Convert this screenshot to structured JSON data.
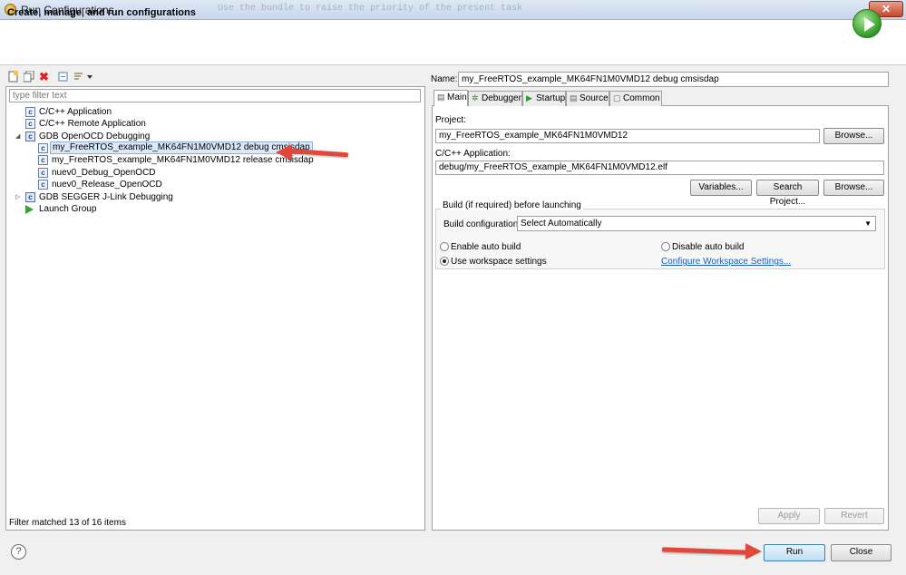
{
  "window": {
    "title": "Run Configurations",
    "ghost_text": "Use the bundle to raise the priority of the present task",
    "close_glyph": "✕"
  },
  "header": {
    "title": "Create, manage, and run configurations",
    "run_icon": "run-icon"
  },
  "left": {
    "toolbar_icons": [
      "new-config-icon",
      "duplicate-icon",
      "delete-icon",
      "collapse-all-icon",
      "filter-icon"
    ],
    "filter_placeholder": "type filter text",
    "tree": [
      {
        "label": "C/C++ Application",
        "level": 0,
        "twisty": "",
        "icon": "c-app-icon"
      },
      {
        "label": "C/C++ Remote Application",
        "level": 0,
        "twisty": "",
        "icon": "c-app-icon"
      },
      {
        "label": "GDB OpenOCD Debugging",
        "level": 0,
        "twisty": "◢",
        "icon": "gdb-icon"
      },
      {
        "label": "my_FreeRTOS_example_MK64FN1M0VMD12 debug cmsisdap",
        "level": 1,
        "twisty": "",
        "icon": "c-app-icon",
        "selected": true
      },
      {
        "label": "my_FreeRTOS_example_MK64FN1M0VMD12 release cmsisdap",
        "level": 1,
        "twisty": "",
        "icon": "c-app-icon"
      },
      {
        "label": "nuev0_Debug_OpenOCD",
        "level": 1,
        "twisty": "",
        "icon": "c-app-icon"
      },
      {
        "label": "nuev0_Release_OpenOCD",
        "level": 1,
        "twisty": "",
        "icon": "c-app-icon"
      },
      {
        "label": "GDB SEGGER J-Link Debugging",
        "level": 0,
        "twisty": "▷",
        "icon": "gdb-icon"
      },
      {
        "label": "Launch Group",
        "level": 0,
        "twisty": "",
        "icon": "launch-group-icon"
      }
    ],
    "status": "Filter matched 13 of 16 items"
  },
  "right": {
    "name_label": "Name:",
    "name_value": "my_FreeRTOS_example_MK64FN1M0VMD12 debug cmsisdap",
    "tabs": [
      {
        "label": "Main",
        "icon": "main-tab-icon",
        "glyph": "▤",
        "active": true
      },
      {
        "label": "Debugger",
        "icon": "debugger-tab-icon",
        "glyph": "✲"
      },
      {
        "label": "Startup",
        "icon": "startup-tab-icon",
        "glyph": "▶"
      },
      {
        "label": "Source",
        "icon": "source-tab-icon",
        "glyph": "▤"
      },
      {
        "label": "Common",
        "icon": "common-tab-icon",
        "glyph": "▢"
      }
    ],
    "project_label": "Project:",
    "project_value": "my_FreeRTOS_example_MK64FN1M0VMD12",
    "browse_label": "Browse...",
    "app_label": "C/C++ Application:",
    "app_value": "debug/my_FreeRTOS_example_MK64FN1M0VMD12.elf",
    "variables_label": "Variables...",
    "search_project_label": "Search Project...",
    "build_group_title": "Build (if required) before launching",
    "build_config_label": "Build configuration:",
    "build_config_value": "Select Automatically",
    "enable_auto_build": "Enable auto build",
    "disable_auto_build": "Disable auto build",
    "use_workspace_settings": "Use workspace settings",
    "configure_workspace_link": "Configure Workspace Settings...",
    "selected_option": "use_workspace_settings",
    "apply_label": "Apply",
    "revert_label": "Revert"
  },
  "footer": {
    "help_glyph": "?",
    "run_label": "Run",
    "close_label": "Close"
  },
  "colors": {
    "annotation_arrow": "#e2473a",
    "selection": "#dbe8f7",
    "link": "#1a5fb4"
  }
}
